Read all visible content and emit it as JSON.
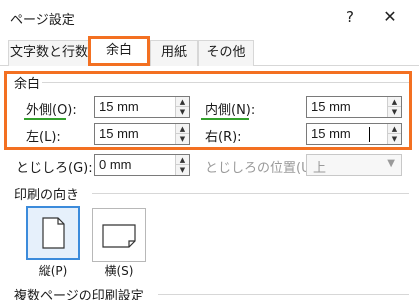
{
  "window": {
    "title": "ページ設定",
    "help": "?",
    "close": "✕"
  },
  "tabs": [
    {
      "label": "文字数と行数"
    },
    {
      "label": "余白"
    },
    {
      "label": "用紙"
    },
    {
      "label": "その他"
    }
  ],
  "margins": {
    "section_label": "余白",
    "outside_label": "外側(O):",
    "outside_value": "15 mm",
    "inside_label": "内側(N):",
    "inside_value": "15 mm",
    "left_label": "左(L):",
    "left_value": "15 mm",
    "right_label": "右(R):",
    "right_value": "15 mm",
    "gutter_label": "とじしろ(G):",
    "gutter_value": "0 mm",
    "gutter_pos_label": "とじしろの位置(U):",
    "gutter_pos_value": "上"
  },
  "orientation": {
    "section_label": "印刷の向き",
    "portrait_label": "縦(P)",
    "landscape_label": "横(S)"
  },
  "multi_page": {
    "section_label": "複数ページの印刷設定"
  },
  "colors": {
    "highlight": "#f37021",
    "underline": "#33a02c",
    "selected": "#3c8bdb"
  }
}
